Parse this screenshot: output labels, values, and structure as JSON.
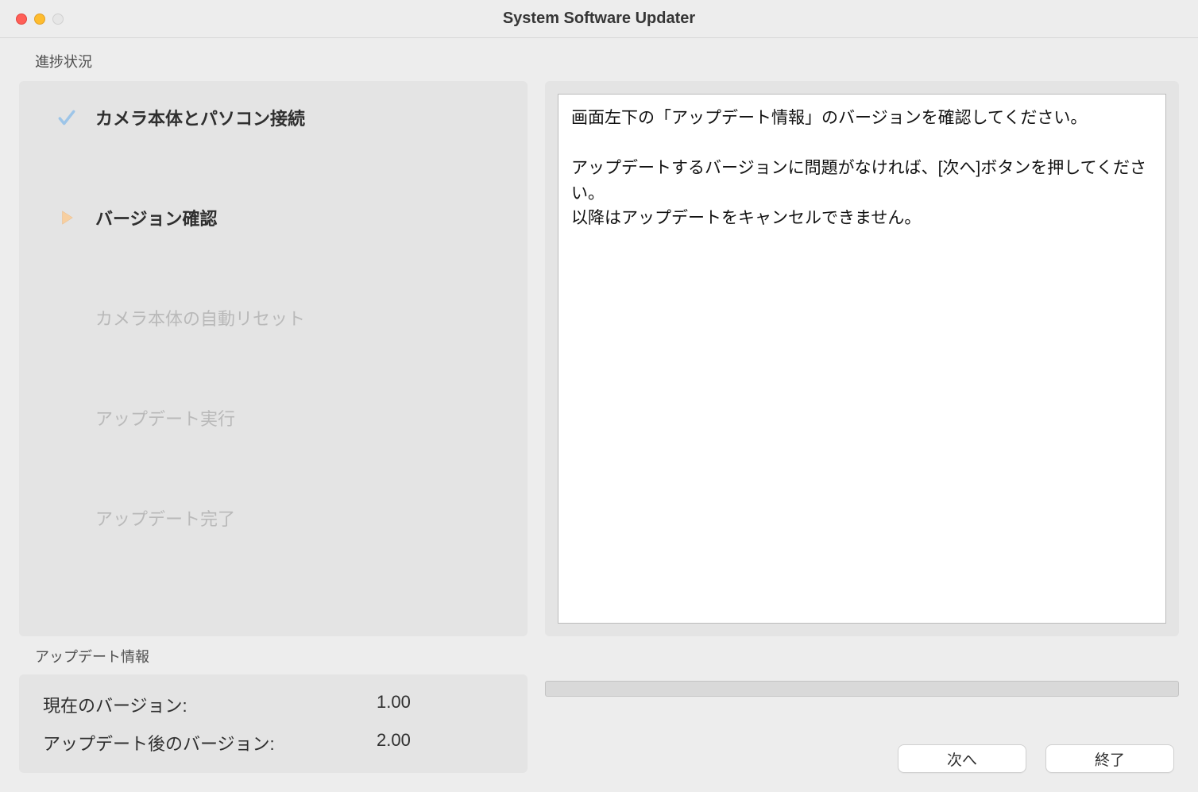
{
  "window": {
    "title": "System Software Updater"
  },
  "progress": {
    "section_label": "進捗状況",
    "steps": [
      {
        "label": "カメラ本体とパソコン接続",
        "state": "done"
      },
      {
        "label": "バージョン確認",
        "state": "current"
      },
      {
        "label": "カメラ本体の自動リセット",
        "state": "pending"
      },
      {
        "label": "アップデート実行",
        "state": "pending"
      },
      {
        "label": "アップデート完了",
        "state": "pending"
      }
    ]
  },
  "info_text": {
    "line1": "画面左下の「アップデート情報」のバージョンを確認してください。",
    "line2": "アップデートするバージョンに問題がなければ、[次へ]ボタンを押してください。",
    "line3": "以降はアップデートをキャンセルできません。"
  },
  "update_info": {
    "section_label": "アップデート情報",
    "current_label": "現在のバージョン:",
    "current_value": "1.00",
    "after_label": "アップデート後のバージョン:",
    "after_value": "2.00"
  },
  "buttons": {
    "next": "次へ",
    "exit": "終了"
  }
}
